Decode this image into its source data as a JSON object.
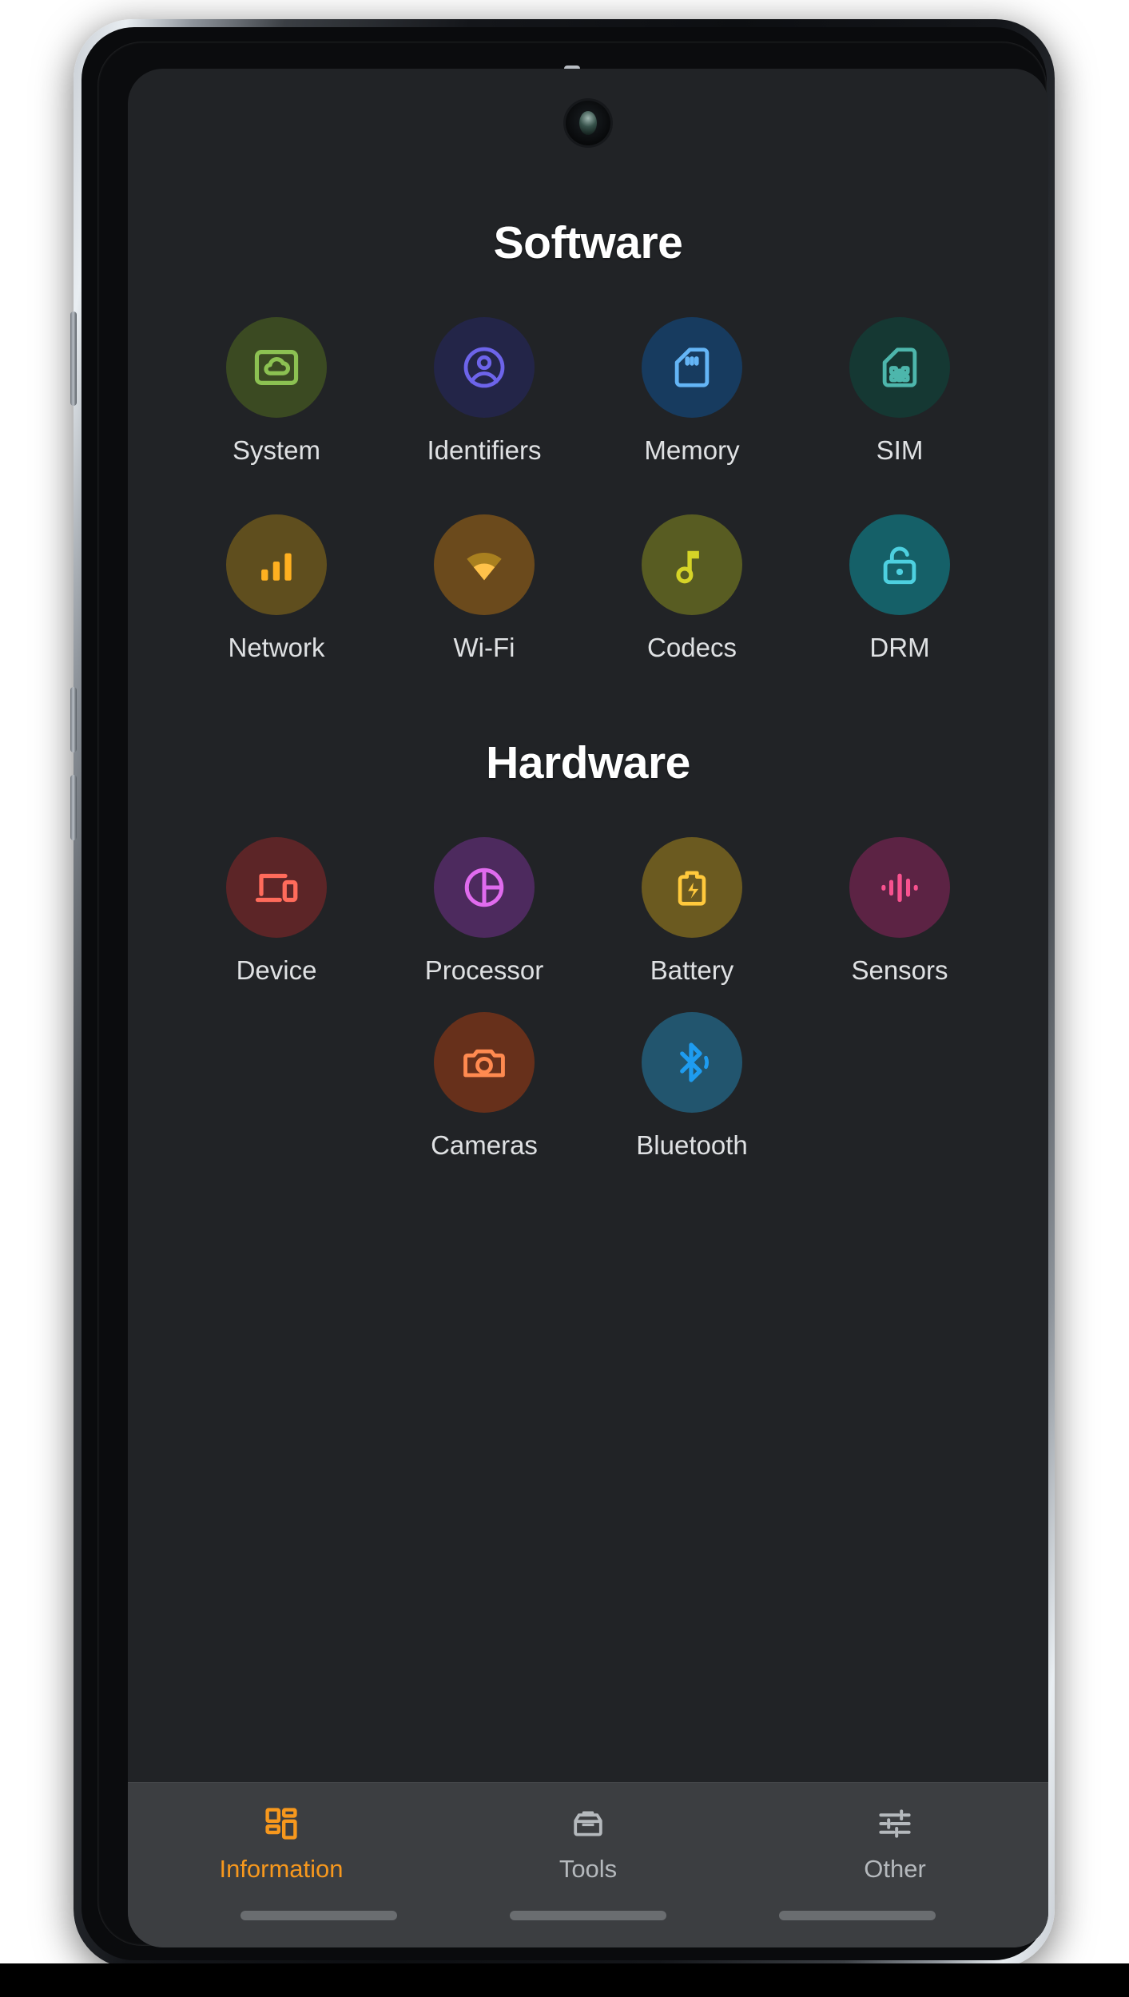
{
  "app": {
    "sections": [
      {
        "title": "Software",
        "rows": [
          [
            {
              "label": "System",
              "icon": "cloud-screen-icon",
              "circle": "#3b4a22",
              "fg": "#8cc152"
            },
            {
              "label": "Identifiers",
              "icon": "account-circle-icon",
              "circle": "#232548",
              "fg": "#6d64ea"
            },
            {
              "label": "Memory",
              "icon": "sd-card-icon",
              "circle": "#173b5f",
              "fg": "#64b5f6"
            },
            {
              "label": "SIM",
              "icon": "sim-card-icon",
              "circle": "#153833",
              "fg": "#4db6ac"
            }
          ],
          [
            {
              "label": "Network",
              "icon": "signal-bars-icon",
              "circle": "#5f4e1e",
              "fg": "#ffb020"
            },
            {
              "label": "Wi-Fi",
              "icon": "wifi-icon",
              "circle": "#6b4a1c",
              "fg": "#ffc24a"
            },
            {
              "label": "Codecs",
              "icon": "music-note-icon",
              "circle": "#585c22",
              "fg": "#d6d427"
            },
            {
              "label": "DRM",
              "icon": "unlock-icon",
              "circle": "#156068",
              "fg": "#4dd0e0"
            }
          ]
        ]
      },
      {
        "title": "Hardware",
        "rows": [
          [
            {
              "label": "Device",
              "icon": "devices-icon",
              "circle": "#5c2527",
              "fg": "#ff6b5b"
            },
            {
              "label": "Processor",
              "icon": "processor-icon",
              "circle": "#4d2a5e",
              "fg": "#e06bee"
            },
            {
              "label": "Battery",
              "icon": "battery-icon",
              "circle": "#6b5a20",
              "fg": "#ffc93c"
            },
            {
              "label": "Sensors",
              "icon": "waveform-icon",
              "circle": "#5c2344",
              "fg": "#f8528f"
            }
          ],
          [
            {
              "label": "Cameras",
              "icon": "camera-icon",
              "circle": "#67301b",
              "fg": "#ff8a50"
            },
            {
              "label": "Bluetooth",
              "icon": "bluetooth-icon",
              "circle": "#22556e",
              "fg": "#1e9cf0"
            }
          ]
        ]
      }
    ],
    "navbar": {
      "items": [
        {
          "label": "Information",
          "icon": "dashboard-grid-icon",
          "active": true
        },
        {
          "label": "Tools",
          "icon": "toolbox-icon",
          "active": false
        },
        {
          "label": "Other",
          "icon": "sliders-icon",
          "active": false
        }
      ],
      "active_color": "#f7981d",
      "inactive_color": "#b5b9bd"
    }
  },
  "theme": {
    "screen_background": "#212326",
    "navbar_background": "#3c3e41",
    "title_color": "#ffffff",
    "label_color": "#dfe1e3"
  }
}
